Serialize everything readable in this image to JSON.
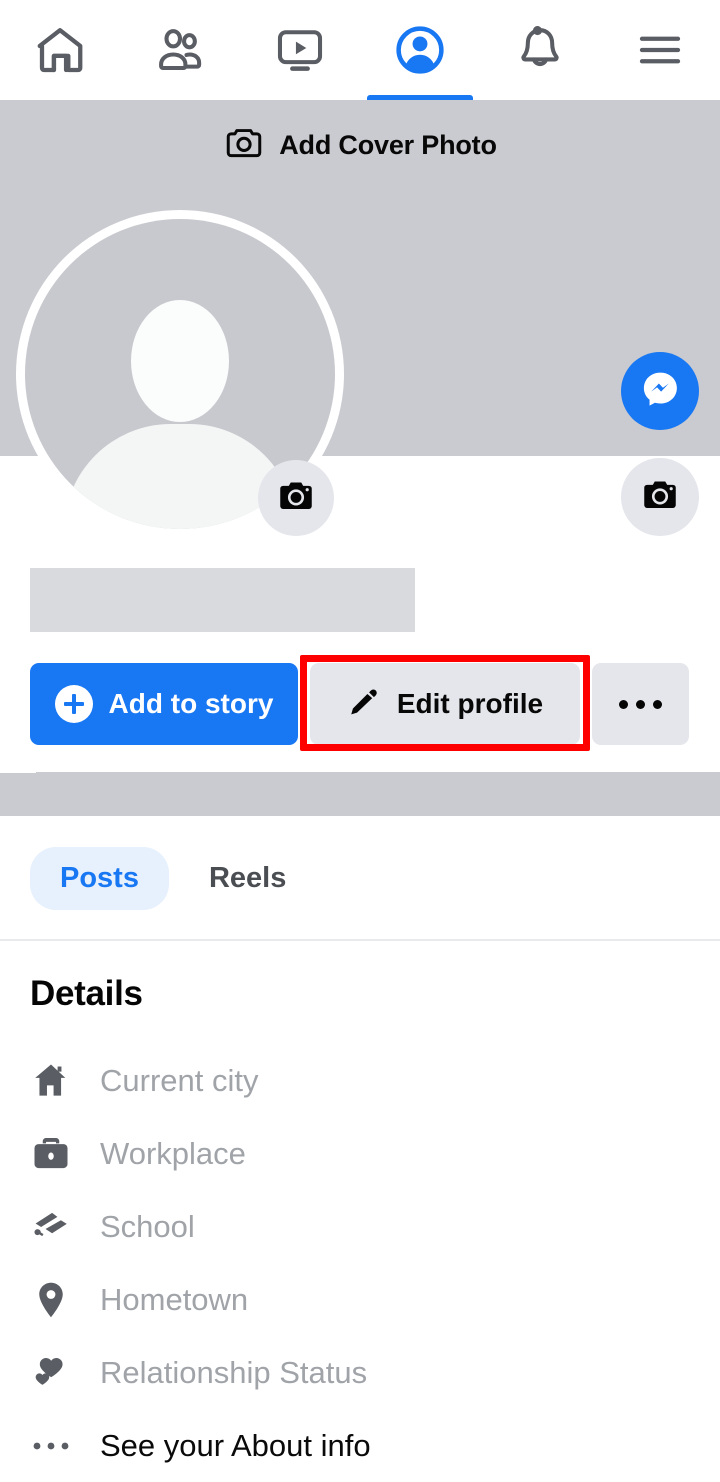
{
  "nav": {
    "items": [
      {
        "name": "home-icon",
        "label": "Home",
        "active": false
      },
      {
        "name": "friends-icon",
        "label": "Friends",
        "active": false
      },
      {
        "name": "video-icon",
        "label": "Video",
        "active": false
      },
      {
        "name": "profile-icon",
        "label": "Profile",
        "active": true
      },
      {
        "name": "notifications-icon",
        "label": "Notifications",
        "active": false
      },
      {
        "name": "menu-icon",
        "label": "Menu",
        "active": false
      }
    ]
  },
  "cover": {
    "add_cover_label": "Add Cover Photo",
    "camera_icon": "camera-icon",
    "chat_icon": "messenger-chat-icon",
    "cover_camera_icon": "camera-icon",
    "background_color": "#cacbd0"
  },
  "profile": {
    "avatar_icon": "default-avatar-icon",
    "avatar_camera_icon": "camera-icon",
    "name_placeholder": ""
  },
  "actions": {
    "add_story_label": "Add to story",
    "add_story_icon": "plus-circle-icon",
    "edit_profile_label": "Edit profile",
    "edit_profile_icon": "pencil-icon",
    "more_icon": "ellipsis-icon",
    "highlight_color": "#ff0000",
    "primary_color": "#1877f2",
    "secondary_color": "#e4e6eb"
  },
  "tabs": [
    {
      "label": "Posts",
      "active": true
    },
    {
      "label": "Reels",
      "active": false
    }
  ],
  "details": {
    "heading": "Details",
    "rows": [
      {
        "icon": "house-icon",
        "label": "Current city",
        "strong": false
      },
      {
        "icon": "briefcase-icon",
        "label": "Workplace",
        "strong": false
      },
      {
        "icon": "graduation-icon",
        "label": "School",
        "strong": false
      },
      {
        "icon": "location-pin-icon",
        "label": "Hometown",
        "strong": false
      },
      {
        "icon": "hearts-icon",
        "label": "Relationship Status",
        "strong": false
      },
      {
        "icon": "ellipsis-icon",
        "label": "See your About info",
        "strong": true
      }
    ]
  }
}
